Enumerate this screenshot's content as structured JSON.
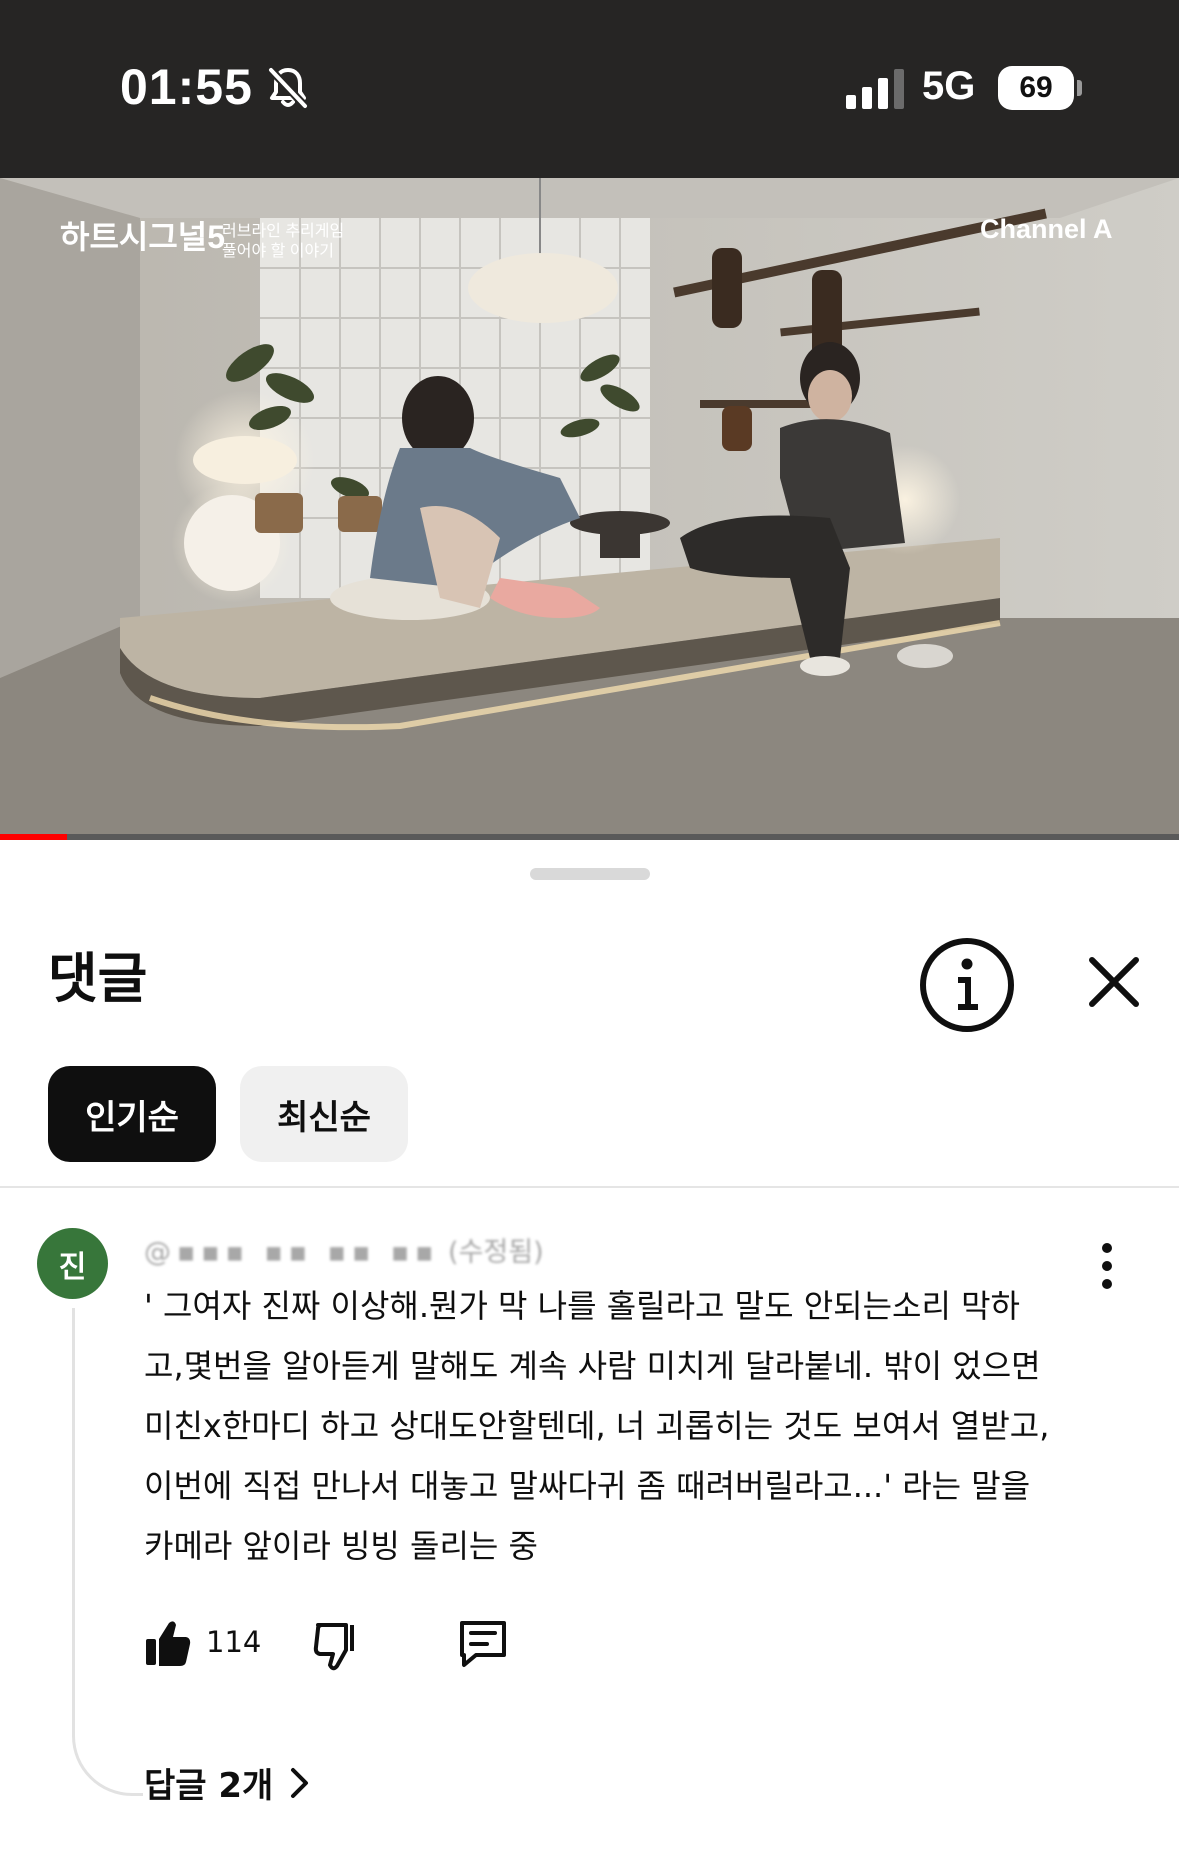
{
  "status_bar": {
    "time": "01:55",
    "network": "5G",
    "battery": "69",
    "icons": [
      "bell-slash-icon",
      "signal-icon",
      "battery-icon"
    ]
  },
  "video": {
    "show_title": "하트시그널5",
    "overlay_line1": "러브라인 추리게임",
    "overlay_line2": "풀어야 할 이야기",
    "channel_logo": "Channel A",
    "progress": 0.057
  },
  "sheet": {
    "title": "댓글",
    "info_icon": "info-icon",
    "close_icon": "close-icon"
  },
  "sort_chips": [
    {
      "label": "인기순",
      "active": true
    },
    {
      "label": "최신순",
      "active": false
    }
  ],
  "comment": {
    "avatar_letter": "진",
    "avatar_color": "#37763a",
    "author_meta": "(수정됨)",
    "text": "' 그여자 진짜 이상해.뭔가 막 나를 홀릴라고  말도 안되는소리 막하\n고,몇번을 알아듣게 말해도 계속 사람 미치게 달라붙네. 밖이  었으면\n미친x한마디 하고 상대도안할텐데, 너 괴롭히는 것도 보여서 열받고,\n이번에 직접 만나서 대놓고 말싸다귀 좀 때려버릴라고...' 라는 말을\n카메라 앞이라 빙빙 돌리는 중",
    "likes": "114",
    "replies_label": "답글 2개"
  },
  "colors": {
    "status_bg": "#262524",
    "chip_active_bg": "#0f0f0f",
    "chip_inactive_bg": "#f0f0f0",
    "progress_red": "#ff0000"
  }
}
